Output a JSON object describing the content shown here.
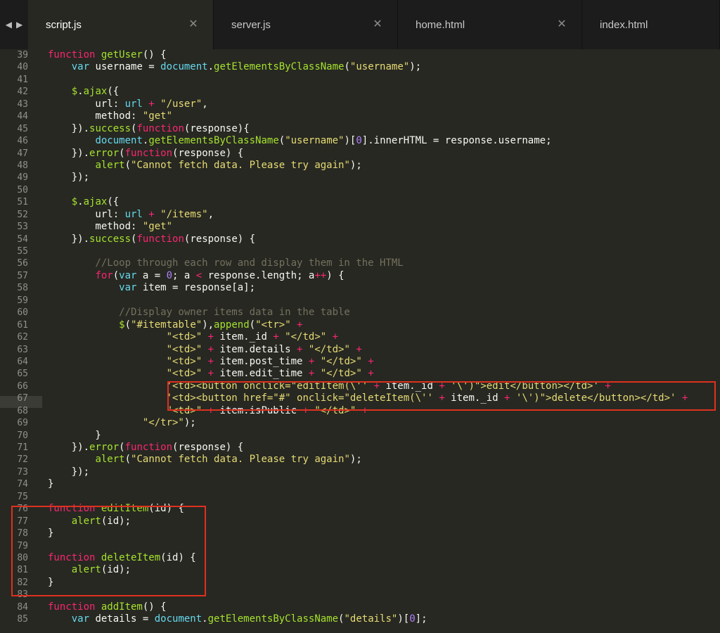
{
  "tabs": [
    {
      "label": "script.js",
      "active": true
    },
    {
      "label": "server.js",
      "active": false
    },
    {
      "label": "home.html",
      "active": false
    },
    {
      "label": "index.html",
      "active": false
    }
  ],
  "gutter": {
    "line_numbers": [
      "39",
      "40",
      "41",
      "42",
      "43",
      "44",
      "45",
      "46",
      "47",
      "48",
      "49",
      "50",
      "51",
      "52",
      "53",
      "54",
      "55",
      "56",
      "57",
      "58",
      "59",
      "60",
      "61",
      "62",
      "63",
      "64",
      "65",
      "66",
      "67",
      "68",
      "69",
      "70",
      "71",
      "72",
      "73",
      "74",
      "75",
      "76",
      "77",
      "78",
      "79",
      "80",
      "81",
      "82",
      "83",
      "84",
      "85"
    ]
  },
  "code_lines": [
    [
      [
        "kw",
        "function "
      ],
      [
        "fn",
        "getUser"
      ],
      [
        "",
        "() {"
      ]
    ],
    [
      [
        "",
        "    "
      ],
      [
        "bi",
        "var "
      ],
      [
        "",
        "username = "
      ],
      [
        "bi",
        "document"
      ],
      [
        "",
        "."
      ],
      [
        "fn",
        "getElementsByClassName"
      ],
      [
        "",
        "("
      ],
      [
        "st",
        "\"username\""
      ],
      [
        "",
        ");"
      ]
    ],
    [
      [
        "",
        ""
      ]
    ],
    [
      [
        "",
        "    "
      ],
      [
        "fn",
        "$"
      ],
      [
        "",
        "."
      ],
      [
        "fn",
        "ajax"
      ],
      [
        "",
        "({"
      ]
    ],
    [
      [
        "",
        "        url: "
      ],
      [
        "bi",
        "url"
      ],
      [
        "kw",
        " + "
      ],
      [
        "st",
        "\"/user\""
      ],
      [
        "",
        ","
      ]
    ],
    [
      [
        "",
        "        method: "
      ],
      [
        "st",
        "\"get\""
      ]
    ],
    [
      [
        "",
        "    })."
      ],
      [
        "fn",
        "success"
      ],
      [
        "",
        "("
      ],
      [
        "kw",
        "function"
      ],
      [
        "",
        "(response){"
      ]
    ],
    [
      [
        "",
        "        "
      ],
      [
        "bi",
        "document"
      ],
      [
        "",
        "."
      ],
      [
        "fn",
        "getElementsByClassName"
      ],
      [
        "",
        "("
      ],
      [
        "st",
        "\"username\""
      ],
      [
        "",
        ")["
      ],
      [
        "nu",
        "0"
      ],
      [
        "",
        "].innerHTML = response.username;"
      ]
    ],
    [
      [
        "",
        "    })."
      ],
      [
        "fn",
        "error"
      ],
      [
        "",
        "("
      ],
      [
        "kw",
        "function"
      ],
      [
        "",
        "(response) {"
      ]
    ],
    [
      [
        "",
        "        "
      ],
      [
        "fn",
        "alert"
      ],
      [
        "",
        "("
      ],
      [
        "st",
        "\"Cannot fetch data. Please try again\""
      ],
      [
        "",
        ");"
      ]
    ],
    [
      [
        "",
        "    });"
      ]
    ],
    [
      [
        "",
        ""
      ]
    ],
    [
      [
        "",
        "    "
      ],
      [
        "fn",
        "$"
      ],
      [
        "",
        "."
      ],
      [
        "fn",
        "ajax"
      ],
      [
        "",
        "({"
      ]
    ],
    [
      [
        "",
        "        url: "
      ],
      [
        "bi",
        "url"
      ],
      [
        "kw",
        " + "
      ],
      [
        "st",
        "\"/items\""
      ],
      [
        "",
        ","
      ]
    ],
    [
      [
        "",
        "        method: "
      ],
      [
        "st",
        "\"get\""
      ]
    ],
    [
      [
        "",
        "    })."
      ],
      [
        "fn",
        "success"
      ],
      [
        "",
        "("
      ],
      [
        "kw",
        "function"
      ],
      [
        "",
        "(response) {"
      ]
    ],
    [
      [
        "",
        ""
      ]
    ],
    [
      [
        "cm",
        "        //Loop through each row and display them in the HTML"
      ]
    ],
    [
      [
        "",
        "        "
      ],
      [
        "kw",
        "for"
      ],
      [
        "",
        "("
      ],
      [
        "bi",
        "var "
      ],
      [
        "",
        "a = "
      ],
      [
        "nu",
        "0"
      ],
      [
        "",
        "; a "
      ],
      [
        "kw",
        "<"
      ],
      [
        "",
        " response.length; a"
      ],
      [
        "kw",
        "++"
      ],
      [
        "",
        ") {"
      ]
    ],
    [
      [
        "",
        "            "
      ],
      [
        "bi",
        "var "
      ],
      [
        "",
        "item = response[a];"
      ]
    ],
    [
      [
        "",
        ""
      ]
    ],
    [
      [
        "cm",
        "            //Display owner items data in the table"
      ]
    ],
    [
      [
        "",
        "            "
      ],
      [
        "fn",
        "$"
      ],
      [
        "",
        "("
      ],
      [
        "st",
        "\"#itemtable\""
      ],
      [
        "",
        "),"
      ],
      [
        "fn",
        "append"
      ],
      [
        "",
        "("
      ],
      [
        "st",
        "\"<tr>\""
      ],
      [
        "kw",
        " +"
      ]
    ],
    [
      [
        "",
        "                    "
      ],
      [
        "st",
        "\"<td>\""
      ],
      [
        "kw",
        " + "
      ],
      [
        "",
        "item._id "
      ],
      [
        "kw",
        "+ "
      ],
      [
        "st",
        "\"</td>\""
      ],
      [
        "kw",
        " +"
      ]
    ],
    [
      [
        "",
        "                    "
      ],
      [
        "st",
        "\"<td>\""
      ],
      [
        "kw",
        " + "
      ],
      [
        "",
        "item.details "
      ],
      [
        "kw",
        "+ "
      ],
      [
        "st",
        "\"</td>\""
      ],
      [
        "kw",
        " +"
      ]
    ],
    [
      [
        "",
        "                    "
      ],
      [
        "st",
        "\"<td>\""
      ],
      [
        "kw",
        " + "
      ],
      [
        "",
        "item.post_time "
      ],
      [
        "kw",
        "+ "
      ],
      [
        "st",
        "\"</td>\""
      ],
      [
        "kw",
        " +"
      ]
    ],
    [
      [
        "",
        "                    "
      ],
      [
        "st",
        "\"<td>\""
      ],
      [
        "kw",
        " + "
      ],
      [
        "",
        "item.edit_time "
      ],
      [
        "kw",
        "+ "
      ],
      [
        "st",
        "\"</td>\""
      ],
      [
        "kw",
        " +"
      ]
    ],
    [
      [
        "",
        "                    "
      ],
      [
        "st",
        "'<td><button onclick=\"editItem(\\'' "
      ],
      [
        "kw",
        "+ "
      ],
      [
        "",
        "item._id "
      ],
      [
        "kw",
        "+ "
      ],
      [
        "st",
        "'\\')\">edit</button></td>'"
      ],
      [
        "kw",
        " +"
      ]
    ],
    [
      [
        "",
        "                    "
      ],
      [
        "st",
        "'<td><button href=\"#\" onclick=\"deleteItem(\\'' "
      ],
      [
        "kw",
        "+ "
      ],
      [
        "",
        "item._id "
      ],
      [
        "kw",
        "+ "
      ],
      [
        "st",
        "'\\')\">delete</button></td>'"
      ],
      [
        "kw",
        " +"
      ]
    ],
    [
      [
        "",
        "                    "
      ],
      [
        "st",
        "\"<td>\""
      ],
      [
        "kw",
        " + "
      ],
      [
        "",
        "item.isPublic "
      ],
      [
        "kw",
        "+ "
      ],
      [
        "st",
        "\"</td>\""
      ],
      [
        "kw",
        " +"
      ]
    ],
    [
      [
        "",
        "                "
      ],
      [
        "st",
        "\"</tr>\""
      ],
      [
        "",
        ");"
      ]
    ],
    [
      [
        "",
        "        }"
      ]
    ],
    [
      [
        "",
        "    })."
      ],
      [
        "fn",
        "error"
      ],
      [
        "",
        "("
      ],
      [
        "kw",
        "function"
      ],
      [
        "",
        "(response) {"
      ]
    ],
    [
      [
        "",
        "        "
      ],
      [
        "fn",
        "alert"
      ],
      [
        "",
        "("
      ],
      [
        "st",
        "\"Cannot fetch data. Please try again\""
      ],
      [
        "",
        ");"
      ]
    ],
    [
      [
        "",
        "    });"
      ]
    ],
    [
      [
        "",
        "}"
      ]
    ],
    [
      [
        "",
        ""
      ]
    ],
    [
      [
        "kw",
        "function "
      ],
      [
        "fn",
        "editItem"
      ],
      [
        "",
        "(id) {"
      ]
    ],
    [
      [
        "",
        "    "
      ],
      [
        "fn",
        "alert"
      ],
      [
        "",
        "(id);"
      ]
    ],
    [
      [
        "",
        "}"
      ]
    ],
    [
      [
        "",
        ""
      ]
    ],
    [
      [
        "kw",
        "function "
      ],
      [
        "fn",
        "deleteItem"
      ],
      [
        "",
        "(id) {"
      ]
    ],
    [
      [
        "",
        "    "
      ],
      [
        "fn",
        "alert"
      ],
      [
        "",
        "(id);"
      ]
    ],
    [
      [
        "",
        "}"
      ]
    ],
    [
      [
        "",
        ""
      ]
    ],
    [
      [
        "kw",
        "function "
      ],
      [
        "fn",
        "addItem"
      ],
      [
        "",
        "() {"
      ]
    ],
    [
      [
        "",
        "    "
      ],
      [
        "bi",
        "var "
      ],
      [
        "",
        "details = "
      ],
      [
        "bi",
        "document"
      ],
      [
        "",
        "."
      ],
      [
        "fn",
        "getElementsByClassName"
      ],
      [
        "",
        "("
      ],
      [
        "st",
        "\"details\""
      ],
      [
        "",
        ")["
      ],
      [
        "nu",
        "0"
      ],
      [
        "",
        "];"
      ]
    ]
  ]
}
